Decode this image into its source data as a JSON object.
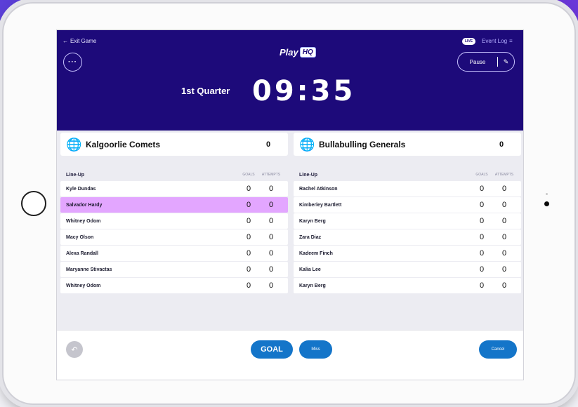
{
  "header": {
    "exit_label": "Exit Game",
    "more_label": "···",
    "logo_text": "Play",
    "logo_hq": "HQ",
    "live_badge": "LIVE",
    "event_log_label": "Event Log",
    "pause_label": "Pause",
    "quarter": "1st Quarter",
    "clock": "09:35"
  },
  "teams": {
    "home": {
      "name": "Kalgoorlie Comets",
      "score": "0"
    },
    "away": {
      "name": "Bullabulling Generals",
      "score": "0"
    }
  },
  "lineup_home": {
    "title": "Line-Up",
    "col_goals": "GOALS",
    "col_attempts": "ATTEMPTS",
    "players": [
      {
        "name": "Kyle Dundas",
        "goals": "0",
        "attempts": "0"
      },
      {
        "name": "Salvador Hardy",
        "goals": "0",
        "attempts": "0",
        "selected": true
      },
      {
        "name": "Whitney Odom",
        "goals": "0",
        "attempts": "0"
      },
      {
        "name": "Macy Olson",
        "goals": "0",
        "attempts": "0"
      },
      {
        "name": "Alexa Randall",
        "goals": "0",
        "attempts": "0"
      },
      {
        "name": "Maryanne Stivactas",
        "goals": "0",
        "attempts": "0"
      },
      {
        "name": "Whitney Odom",
        "goals": "0",
        "attempts": "0"
      }
    ]
  },
  "lineup_away": {
    "title": "Line-Up",
    "col_goals": "GOALS",
    "col_attempts": "ATTEMPTS",
    "players": [
      {
        "name": "Rachel Atkinson",
        "goals": "0",
        "attempts": "0"
      },
      {
        "name": "Kimberley Bartlett",
        "goals": "0",
        "attempts": "0"
      },
      {
        "name": "Karyn Berg",
        "goals": "0",
        "attempts": "0"
      },
      {
        "name": "Zara Diaz",
        "goals": "0",
        "attempts": "0"
      },
      {
        "name": "Kadeem Finch",
        "goals": "0",
        "attempts": "0"
      },
      {
        "name": "Kalia Lee",
        "goals": "0",
        "attempts": "0"
      },
      {
        "name": "Karyn Berg",
        "goals": "0",
        "attempts": "0"
      }
    ]
  },
  "footer": {
    "goal_label": "GOAL",
    "miss_label": "Miss",
    "cancel_label": "Cancel"
  },
  "colors": {
    "header_bg": "#1d0a7a",
    "accent": "#1475c9",
    "highlight_row": "#e3a6ff"
  },
  "icons": {
    "exit": "arrow-left-icon",
    "more": "more-dots-icon",
    "event_log": "list-icon",
    "edit": "pencil-icon",
    "team": "globe-icon",
    "undo": "undo-icon"
  }
}
